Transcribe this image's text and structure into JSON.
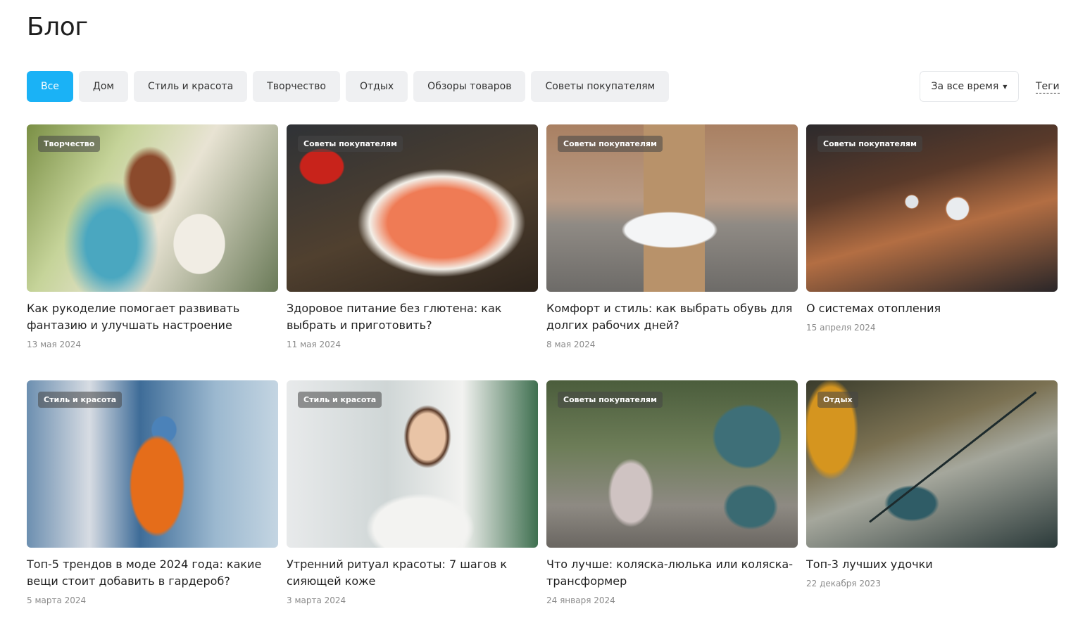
{
  "page": {
    "title": "Блог"
  },
  "filters": [
    {
      "label": "Все",
      "active": true
    },
    {
      "label": "Дом",
      "active": false
    },
    {
      "label": "Стиль и красота",
      "active": false
    },
    {
      "label": "Творчество",
      "active": false
    },
    {
      "label": "Отдых",
      "active": false
    },
    {
      "label": "Обзоры товаров",
      "active": false
    },
    {
      "label": "Советы покупателям",
      "active": false
    }
  ],
  "sort": {
    "label": "За все время",
    "icon": "caret-down-icon"
  },
  "tags_link": "Теги",
  "colors": {
    "accent": "#1ab2f6",
    "chip_bg": "#eff0f2",
    "date": "#8a8a8a"
  },
  "posts": [
    {
      "category": "Творчество",
      "title": "Как рукоделие помогает развивать фантазию и улучшать настроение",
      "date": "13 мая 2024"
    },
    {
      "category": "Советы покупателям",
      "title": "Здоровое питание без глютена: как выбрать и приготовить?",
      "date": "11 мая 2024"
    },
    {
      "category": "Советы покупателям",
      "title": "Комфорт и стиль: как выбрать обувь для долгих рабочих дней?",
      "date": "8 мая 2024"
    },
    {
      "category": "Советы покупателям",
      "title": "О системах отопления",
      "date": "15 апреля 2024"
    },
    {
      "category": "Стиль и красота",
      "title": "Топ-5 трендов в моде 2024 года: какие вещи стоит добавить в гардероб?",
      "date": "5 марта 2024"
    },
    {
      "category": "Стиль и красота",
      "title": "Утренний ритуал красоты: 7 шагов к сияющей коже",
      "date": "3 марта 2024"
    },
    {
      "category": "Советы покупателям",
      "title": "Что лучше: коляска-люлька или коляска-трансформер",
      "date": "24 января 2024"
    },
    {
      "category": "Отдых",
      "title": "Топ-3 лучших удочки",
      "date": "22 декабря 2023"
    }
  ]
}
